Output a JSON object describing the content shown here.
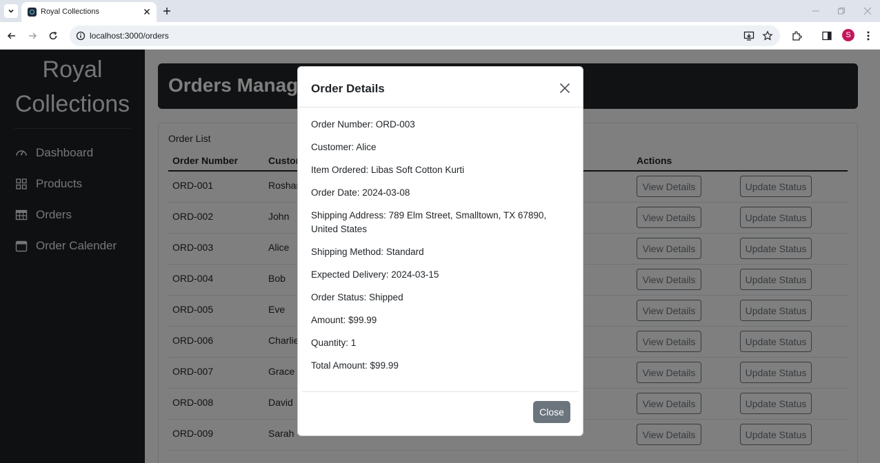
{
  "browser": {
    "tab_title": "Royal Collections",
    "url": "localhost:3000/orders",
    "profile_initial": "S"
  },
  "sidebar": {
    "brand_line1": "Royal",
    "brand_line2": "Collections",
    "items": [
      {
        "label": "Dashboard",
        "icon": "dashboard-gauge-icon"
      },
      {
        "label": "Products",
        "icon": "grid-icon"
      },
      {
        "label": "Orders",
        "icon": "table-icon"
      },
      {
        "label": "Order Calender",
        "icon": "calendar-icon"
      }
    ]
  },
  "header": {
    "title": "Orders Management"
  },
  "table": {
    "label": "Order List",
    "columns": [
      "Order Number",
      "Customer",
      "Actions"
    ],
    "view_label": "View Details",
    "update_label": "Update Status",
    "rows": [
      {
        "order": "ORD-001",
        "customer": "Roshan"
      },
      {
        "order": "ORD-002",
        "customer": "John"
      },
      {
        "order": "ORD-003",
        "customer": "Alice"
      },
      {
        "order": "ORD-004",
        "customer": "Bob"
      },
      {
        "order": "ORD-005",
        "customer": "Eve"
      },
      {
        "order": "ORD-006",
        "customer": "Charlie"
      },
      {
        "order": "ORD-007",
        "customer": "Grace"
      },
      {
        "order": "ORD-008",
        "customer": "David"
      },
      {
        "order": "ORD-009",
        "customer": "Sarah"
      }
    ]
  },
  "modal": {
    "title": "Order Details",
    "details": [
      "Order Number: ORD-003",
      "Customer: Alice",
      "Item Ordered: Libas Soft Cotton Kurti",
      "Order Date: 2024-03-08",
      "Shipping Address: 789 Elm Street, Smalltown, TX 67890, United States",
      "Shipping Method: Standard",
      "Expected Delivery: 2024-03-15",
      "Order Status: Shipped",
      "Amount: $99.99",
      "Quantity: 1",
      "Total Amount: $99.99"
    ],
    "close_label": "Close"
  }
}
